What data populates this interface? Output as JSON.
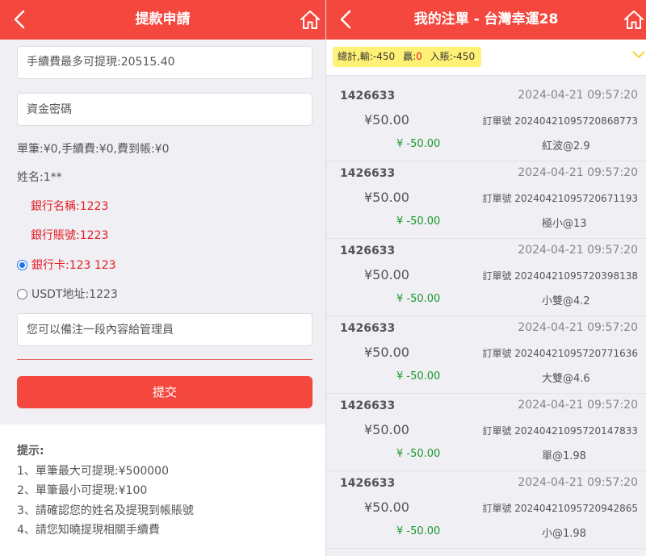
{
  "left": {
    "header": {
      "title": "提款申請"
    },
    "max_withdraw_field": {
      "label": "手續費最多可提現:20515.40"
    },
    "fund_password": {
      "placeholder": "資金密碼"
    },
    "fee_line": "單筆:¥0,手續費:¥0,費到帳:¥0",
    "name_line": "姓名:1**",
    "bank_name_line": "銀行名稱:1223",
    "bank_account_line": "銀行賬號:1223",
    "options": [
      {
        "label": "銀行卡:123 123",
        "selected": true
      },
      {
        "label": "USDT地址:1223",
        "selected": false
      }
    ],
    "remark": {
      "placeholder": "您可以備注一段內容給管理員"
    },
    "submit_label": "提交",
    "tips": {
      "title": "提示:",
      "items": [
        "1、單筆最大可提現:¥500000",
        "2、單筆最小可提現:¥100",
        "3、請確認您的姓名及提現到帳賬號",
        "4、請您知曉提現相關手續費"
      ]
    }
  },
  "right": {
    "header": {
      "title": "我的注單 - 台灣幸運28"
    },
    "summary": {
      "total_label": "總計,",
      "loss_label": "輸:",
      "loss_value": "-450",
      "win_label": "贏:",
      "win_value": "0",
      "deposit_label": "入賬:",
      "deposit_value": "-450"
    },
    "orders": [
      {
        "user": "1426633",
        "time": "2024-04-21 09:57:20",
        "amount": "¥50.00",
        "order_no": "訂單號 20240421095720868773",
        "profit": "¥ -50.00",
        "bet": "紅波@2.9"
      },
      {
        "user": "1426633",
        "time": "2024-04-21 09:57:20",
        "amount": "¥50.00",
        "order_no": "訂單號 20240421095720671193",
        "profit": "¥ -50.00",
        "bet": "極小@13"
      },
      {
        "user": "1426633",
        "time": "2024-04-21 09:57:20",
        "amount": "¥50.00",
        "order_no": "訂單號 20240421095720398138",
        "profit": "¥ -50.00",
        "bet": "小雙@4.2"
      },
      {
        "user": "1426633",
        "time": "2024-04-21 09:57:20",
        "amount": "¥50.00",
        "order_no": "訂單號 20240421095720771636",
        "profit": "¥ -50.00",
        "bet": "大雙@4.6"
      },
      {
        "user": "1426633",
        "time": "2024-04-21 09:57:20",
        "amount": "¥50.00",
        "order_no": "訂單號 20240421095720147833",
        "profit": "¥ -50.00",
        "bet": "單@1.98"
      },
      {
        "user": "1426633",
        "time": "2024-04-21 09:57:20",
        "amount": "¥50.00",
        "order_no": "訂單號 20240421095720942865",
        "profit": "¥ -50.00",
        "bet": "小@1.98"
      }
    ]
  },
  "colors": {
    "brand": "#f4483f",
    "profit_green": "#1a9a2a",
    "alert_red": "#e51c23",
    "summary_bg": "#fff176"
  },
  "icons": [
    "back-icon",
    "home-icon",
    "chevron-down-icon"
  ]
}
